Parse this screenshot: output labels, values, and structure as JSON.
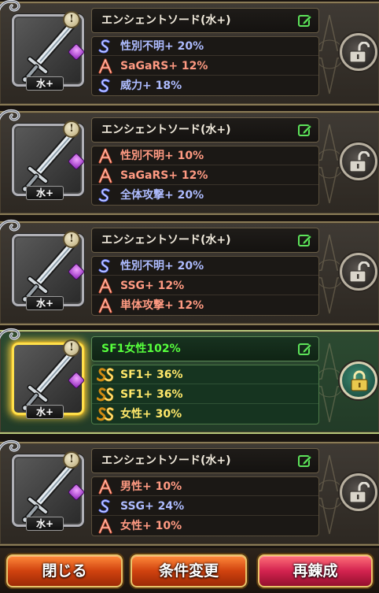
{
  "cards": [
    {
      "name": "エンシェントソード(水+)",
      "element_label": "水+",
      "selected": false,
      "skills": [
        {
          "rank": "S",
          "text": "性別不明+ 20%"
        },
        {
          "rank": "A",
          "text": "SaGaRS+ 12%"
        },
        {
          "rank": "S",
          "text": "威力+ 18%"
        }
      ]
    },
    {
      "name": "エンシェントソード(水+)",
      "element_label": "水+",
      "selected": false,
      "skills": [
        {
          "rank": "A",
          "text": "性別不明+ 10%"
        },
        {
          "rank": "A",
          "text": "SaGaRS+ 12%"
        },
        {
          "rank": "S",
          "text": "全体攻撃+ 20%"
        }
      ]
    },
    {
      "name": "エンシェントソード(水+)",
      "element_label": "水+",
      "selected": false,
      "skills": [
        {
          "rank": "S",
          "text": "性別不明+ 20%"
        },
        {
          "rank": "A",
          "text": "SSG+ 12%"
        },
        {
          "rank": "A",
          "text": "単体攻撃+ 12%"
        }
      ]
    },
    {
      "name": "SF1女性102%",
      "element_label": "水+",
      "selected": true,
      "skills": [
        {
          "rank": "SS",
          "text": "SF1+ 36%"
        },
        {
          "rank": "SS",
          "text": "SF1+ 36%"
        },
        {
          "rank": "SS",
          "text": "女性+ 30%"
        }
      ]
    },
    {
      "name": "エンシェントソード(水+)",
      "element_label": "水+",
      "selected": false,
      "skills": [
        {
          "rank": "A",
          "text": "男性+ 10%"
        },
        {
          "rank": "S",
          "text": "SSG+ 24%"
        },
        {
          "rank": "A",
          "text": "女性+ 10%"
        }
      ]
    }
  ],
  "buttons": {
    "close": "閉じる",
    "change_conditions": "条件変更",
    "reforge": "再錬成"
  },
  "colors": {
    "rank_s": "#aebcff",
    "rank_a": "#ff9a82",
    "rank_ss": "#ffe86a",
    "selected_name": "#56ff3c"
  }
}
